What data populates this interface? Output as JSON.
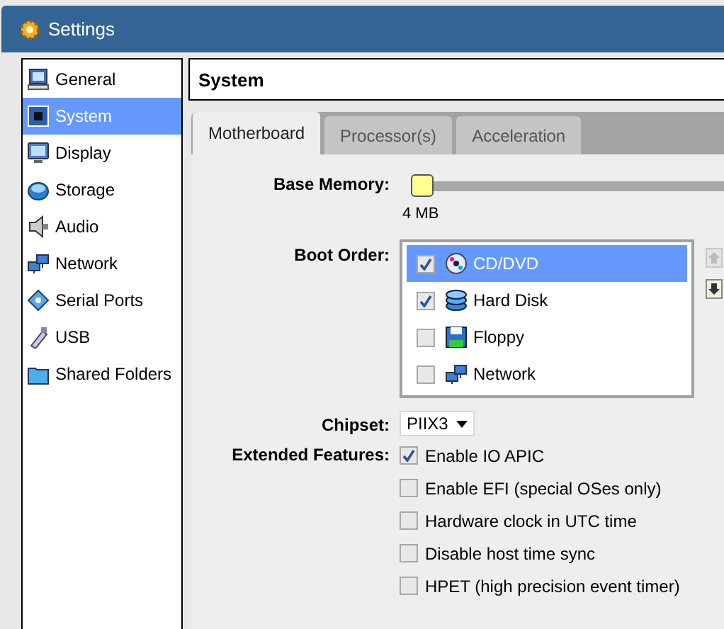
{
  "window": {
    "title": "Settings"
  },
  "sidebar": {
    "items": [
      {
        "label": "General",
        "kind": "monitor",
        "selected": false
      },
      {
        "label": "System",
        "kind": "chip",
        "selected": true
      },
      {
        "label": "Display",
        "kind": "display",
        "selected": false
      },
      {
        "label": "Storage",
        "kind": "disk",
        "selected": false
      },
      {
        "label": "Audio",
        "kind": "speaker",
        "selected": false
      },
      {
        "label": "Network",
        "kind": "network",
        "selected": false
      },
      {
        "label": "Serial Ports",
        "kind": "serial",
        "selected": false
      },
      {
        "label": "USB",
        "kind": "usb",
        "selected": false
      },
      {
        "label": "Shared Folders",
        "kind": "folder",
        "selected": false
      }
    ]
  },
  "page_title": "System",
  "tabs": [
    {
      "label": "Motherboard",
      "selected": true
    },
    {
      "label": "Processor(s)",
      "selected": false
    },
    {
      "label": "Acceleration",
      "selected": false
    }
  ],
  "base_memory": {
    "label": "Base Memory:",
    "level": 0,
    "min_label": "4 MB"
  },
  "boot_order": {
    "label": "Boot Order:",
    "items": [
      {
        "label": "CD/DVD",
        "kind": "cd",
        "checked": true,
        "selected": true
      },
      {
        "label": "Hard Disk",
        "kind": "hdd",
        "checked": true,
        "selected": false
      },
      {
        "label": "Floppy",
        "kind": "floppy",
        "checked": false,
        "selected": false
      },
      {
        "label": "Network",
        "kind": "network",
        "checked": false,
        "selected": false
      }
    ],
    "move_up": {
      "disabled": true
    },
    "move_down": {
      "disabled": false
    }
  },
  "chipset": {
    "label": "Chipset:",
    "value": "PIIX3"
  },
  "extended_features": {
    "label": "Extended Features:",
    "items": [
      {
        "label": "Enable IO APIC",
        "checked": true
      },
      {
        "label": "Enable EFI (special OSes only)",
        "checked": false
      },
      {
        "label": "Hardware clock in UTC time",
        "checked": false
      },
      {
        "label": "Disable host time sync",
        "checked": false
      },
      {
        "label": "HPET (high precision event timer)",
        "checked": false
      }
    ]
  }
}
